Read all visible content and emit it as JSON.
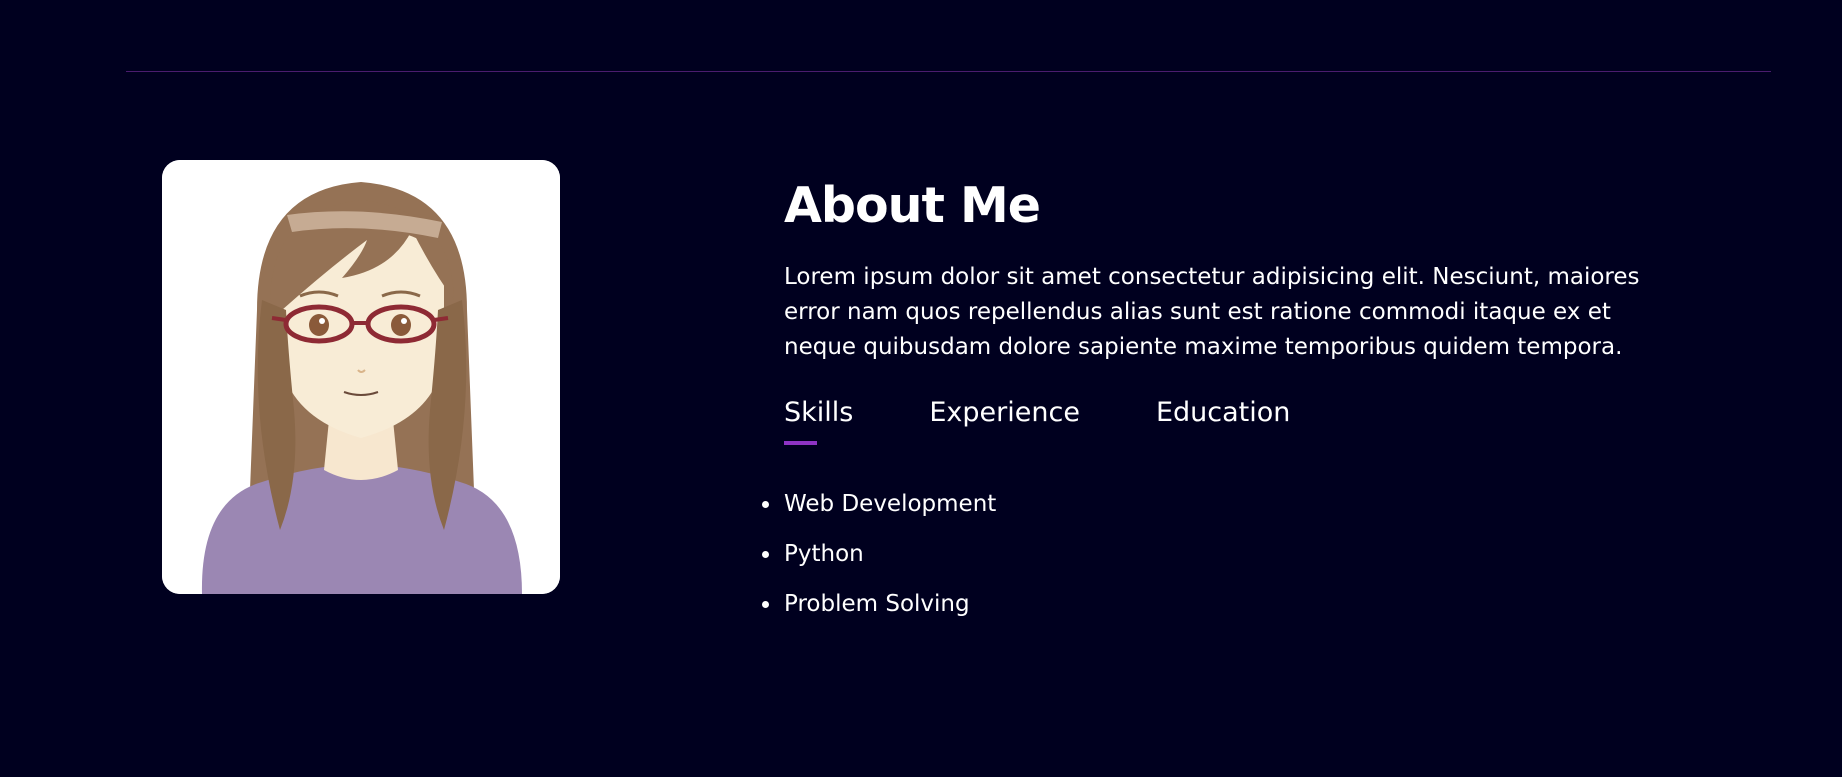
{
  "about": {
    "title": "About Me",
    "description": "Lorem ipsum dolor sit amet consectetur adipisicing elit. Nesciunt, maiores error nam quos repellendus alias sunt est ratione commodi itaque ex et neque quibusdam dolore sapiente maxime temporibus quidem tempora."
  },
  "tabs": [
    {
      "label": "Skills",
      "active": true
    },
    {
      "label": "Experience",
      "active": false
    },
    {
      "label": "Education",
      "active": false
    }
  ],
  "skills": [
    "Web Development",
    "Python",
    "Problem Solving"
  ],
  "colors": {
    "background": "#00001f",
    "accent": "#8e33c4",
    "divider": "#4a1c6e",
    "text": "#ffffff"
  },
  "avatar": {
    "icon": "profile-illustration"
  }
}
